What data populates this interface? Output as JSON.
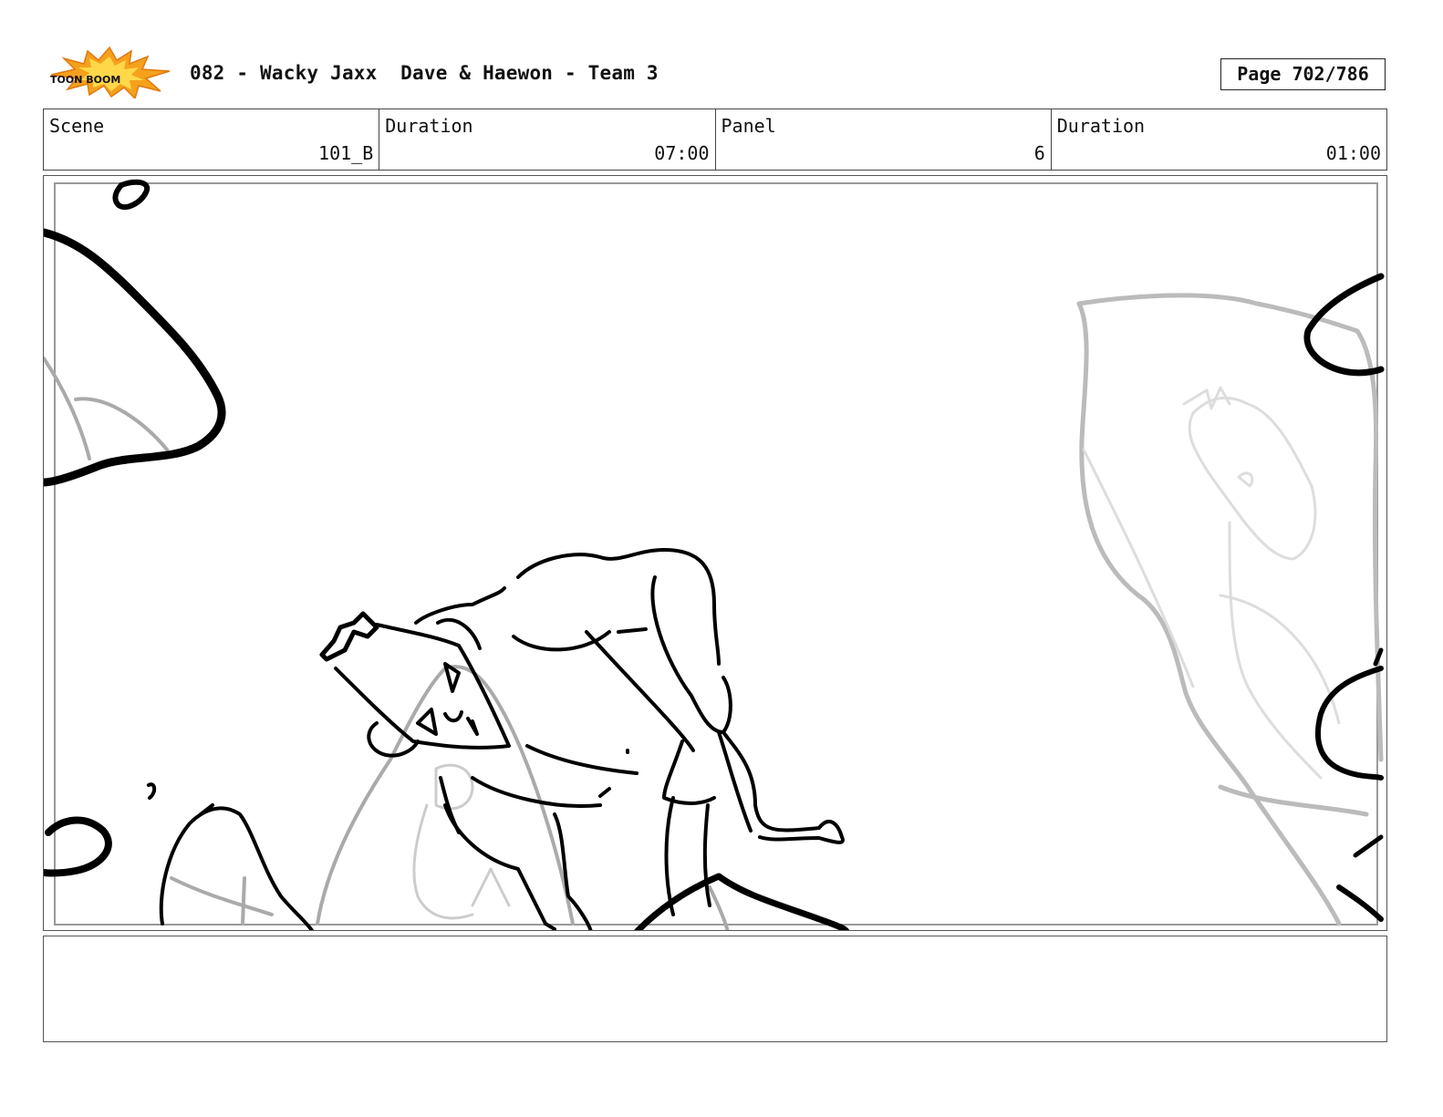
{
  "header": {
    "logo_text": "TOON BOOM",
    "title": "082 - Wacky Jaxx  Dave & Haewon - Team 3",
    "page": "Page 702/786"
  },
  "info": {
    "scene_label": "Scene",
    "scene_value": "101_B",
    "scene_duration_label": "Duration",
    "scene_duration_value": "07:00",
    "panel_label": "Panel",
    "panel_value": "6",
    "panel_duration_label": "Duration",
    "panel_duration_value": "01:00"
  },
  "notes": {
    "text": ""
  }
}
